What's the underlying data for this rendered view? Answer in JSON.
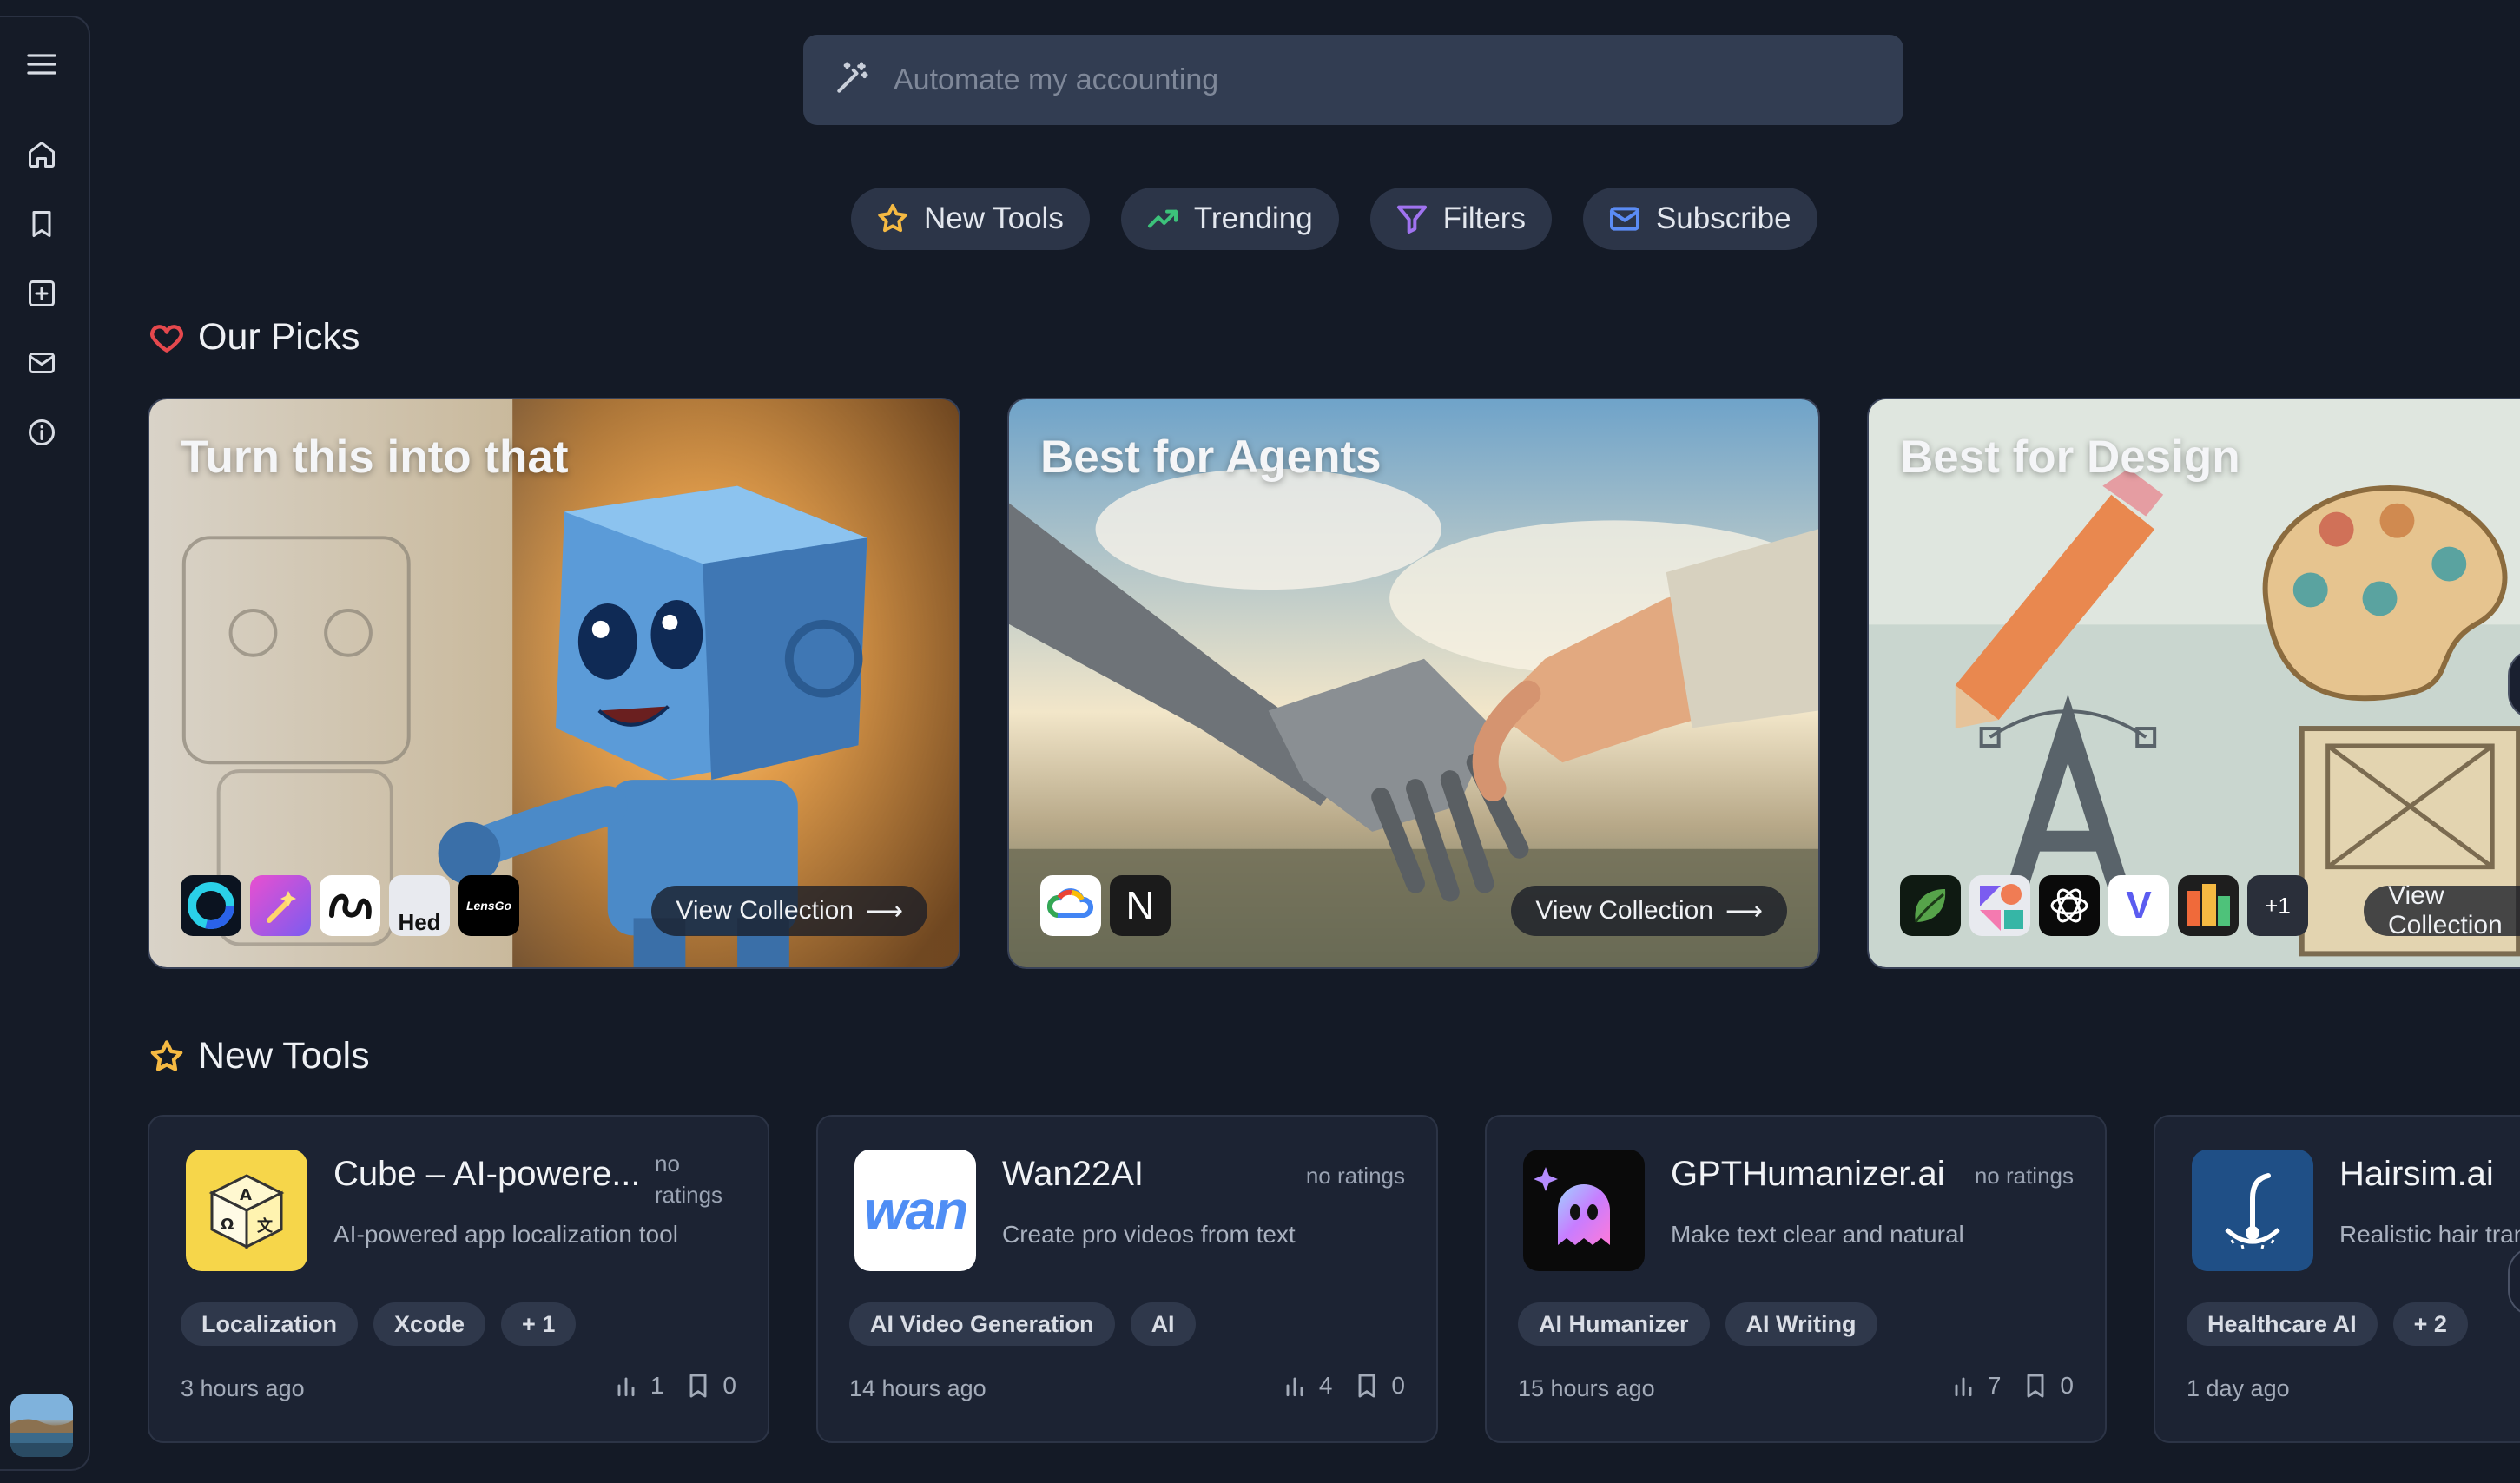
{
  "search": {
    "placeholder": "Automate my accounting"
  },
  "pills": [
    {
      "label": "New Tools",
      "icon": "star-icon",
      "color": "#f5b942"
    },
    {
      "label": "Trending",
      "icon": "trending-up-icon",
      "color": "#3cc27a"
    },
    {
      "label": "Filters",
      "icon": "filter-icon",
      "color": "#a073f0"
    },
    {
      "label": "Subscribe",
      "icon": "mail-icon",
      "color": "#5b8cf5"
    }
  ],
  "picks_section": {
    "title": "Our Picks",
    "icon": "heart-icon",
    "color": "#e5484d"
  },
  "picks": [
    {
      "title": "Turn this into that",
      "button": "View Collection",
      "logos": [
        "",
        "",
        "",
        "Hed",
        "LensGo"
      ]
    },
    {
      "title": "Best for Agents",
      "button": "View Collection",
      "logos": [
        "",
        "N"
      ]
    },
    {
      "title": "Best for Design",
      "button": "View Collection",
      "logos": [
        "",
        "",
        "",
        "V",
        "",
        "+1"
      ]
    }
  ],
  "new_tools_section": {
    "title": "New Tools",
    "icon": "star-icon",
    "color": "#f5b942"
  },
  "tools": [
    {
      "name": "Cube – AI-powere...",
      "rating": "no ratings",
      "description": "AI-powered app localization tool",
      "tags": [
        "Localization",
        "Xcode",
        "+ 1"
      ],
      "time": "3 hours ago",
      "views": "1",
      "saves": "0"
    },
    {
      "name": "Wan22AI",
      "rating": "no ratings",
      "description": "Create pro videos from text",
      "tags": [
        "AI Video Generation",
        "AI"
      ],
      "time": "14 hours ago",
      "views": "4",
      "saves": "0",
      "logo_text": "wan"
    },
    {
      "name": "GPTHumanizer.ai",
      "rating": "no ratings",
      "description": "Make text clear and natural",
      "tags": [
        "AI Humanizer",
        "AI Writing"
      ],
      "time": "15 hours ago",
      "views": "7",
      "saves": "0"
    },
    {
      "name": "Hairsim.ai",
      "rating": "",
      "description": "Realistic hair tran",
      "tags": [
        "Healthcare AI",
        "+ 2"
      ],
      "time": "1 day ago",
      "views": "",
      "saves": ""
    }
  ]
}
